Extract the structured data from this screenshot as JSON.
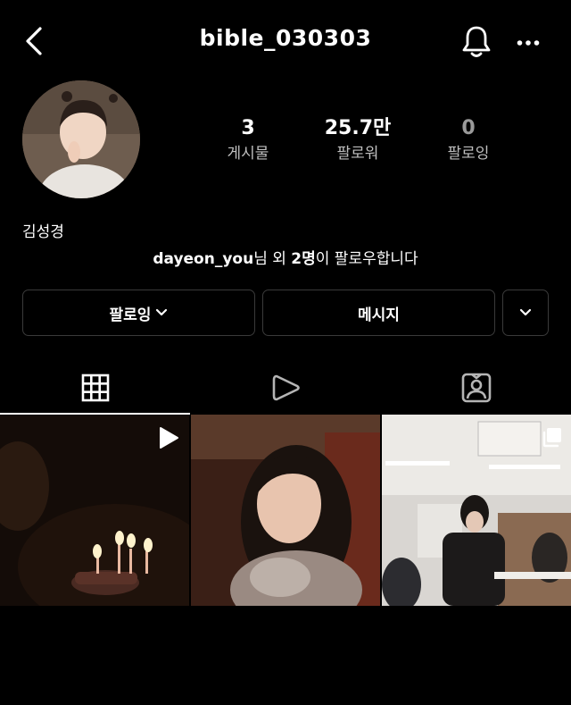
{
  "header": {
    "username": "bible_030303",
    "back_icon": "chevron-left-icon",
    "notification_icon": "bell-icon",
    "more_icon": "more-horizontal-icon"
  },
  "profile": {
    "display_name": "김성경",
    "stats": [
      {
        "value": "3",
        "label": "게시물"
      },
      {
        "value": "25.7만",
        "label": "팔로워"
      },
      {
        "value": "0",
        "label": "팔로잉"
      }
    ],
    "followed_by": {
      "username": "dayeon_you",
      "middle": "님 외 ",
      "count": "2명",
      "suffix": "이 팔로우합니다"
    }
  },
  "actions": {
    "following_label": "팔로잉",
    "message_label": "메시지"
  },
  "tabs": [
    {
      "icon": "grid-icon",
      "active": true
    },
    {
      "icon": "reels-play-icon",
      "active": false
    },
    {
      "icon": "tagged-person-icon",
      "active": false
    }
  ],
  "posts": [
    {
      "type": "reel",
      "badge_icon": "play-icon",
      "subject": "birthday-candles"
    },
    {
      "type": "photo",
      "subject": "child-portrait"
    },
    {
      "type": "carousel",
      "badge_icon": "multiple-posts-icon",
      "subject": "classroom"
    }
  ],
  "colors": {
    "background": "#000000",
    "border": "#3a3a3a",
    "muted": "#9a9a9a"
  }
}
